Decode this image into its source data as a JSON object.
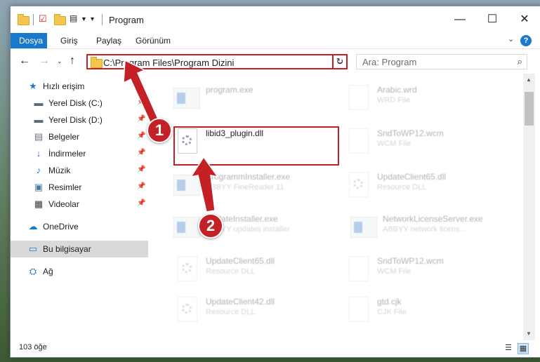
{
  "window": {
    "title": "Program",
    "minimize": "—",
    "maximize": "☐",
    "close": "✕"
  },
  "ribbon": {
    "tabs": [
      "Dosya",
      "Giriş",
      "Paylaş",
      "Görünüm"
    ],
    "help": "?"
  },
  "nav": {
    "address": "C:\\Program Files\\Program Dizini",
    "search_placeholder": "Ara: Program"
  },
  "sidebar": {
    "items": [
      {
        "label": "Hızlı erişim",
        "icon": "star-icon"
      },
      {
        "label": "Yerel Disk (C:)",
        "icon": "drive-icon"
      },
      {
        "label": "Yerel Disk (D:)",
        "icon": "drive-icon"
      },
      {
        "label": "Belgeler",
        "icon": "documents-icon"
      },
      {
        "label": "İndirmeler",
        "icon": "download-icon"
      },
      {
        "label": "Müzik",
        "icon": "music-icon"
      },
      {
        "label": "Resimler",
        "icon": "pictures-icon"
      },
      {
        "label": "Videolar",
        "icon": "videos-icon"
      },
      {
        "label": "OneDrive",
        "icon": "cloud-icon"
      },
      {
        "label": "Bu bilgisayar",
        "icon": "computer-icon"
      },
      {
        "label": "Ağ",
        "icon": "network-icon"
      }
    ]
  },
  "files": [
    {
      "name": "program.exe",
      "type": ""
    },
    {
      "name": "Arabic.wrd",
      "type": "WRD File"
    },
    {
      "name": "libid3_plugin.dll",
      "type": ""
    },
    {
      "name": "SndToWP12.wcm",
      "type": "WCM File"
    },
    {
      "name": "ProgrammInstaller.exe",
      "type": "ABBYY FineReader 11"
    },
    {
      "name": "UpdateClient65.dll",
      "type": "Resource DLL"
    },
    {
      "name": "UpdateInstaller.exe",
      "type": "ABBYY updates installer"
    },
    {
      "name": "NetworkLicenseServer.exe",
      "type": "ABBYY network licens..."
    },
    {
      "name": "UpdateClient65.dll",
      "type": "Resource DLL"
    },
    {
      "name": "SndToWP12.wcm",
      "type": "WCM File"
    },
    {
      "name": "UpdateClient42.dll",
      "type": "Resource DLL"
    },
    {
      "name": "gtd.cjk",
      "type": "CJK File"
    }
  ],
  "status": {
    "count": "103 öğe"
  },
  "callouts": [
    "1",
    "2"
  ],
  "colors": {
    "accent": "#1979ca",
    "highlight": "#c42127"
  }
}
